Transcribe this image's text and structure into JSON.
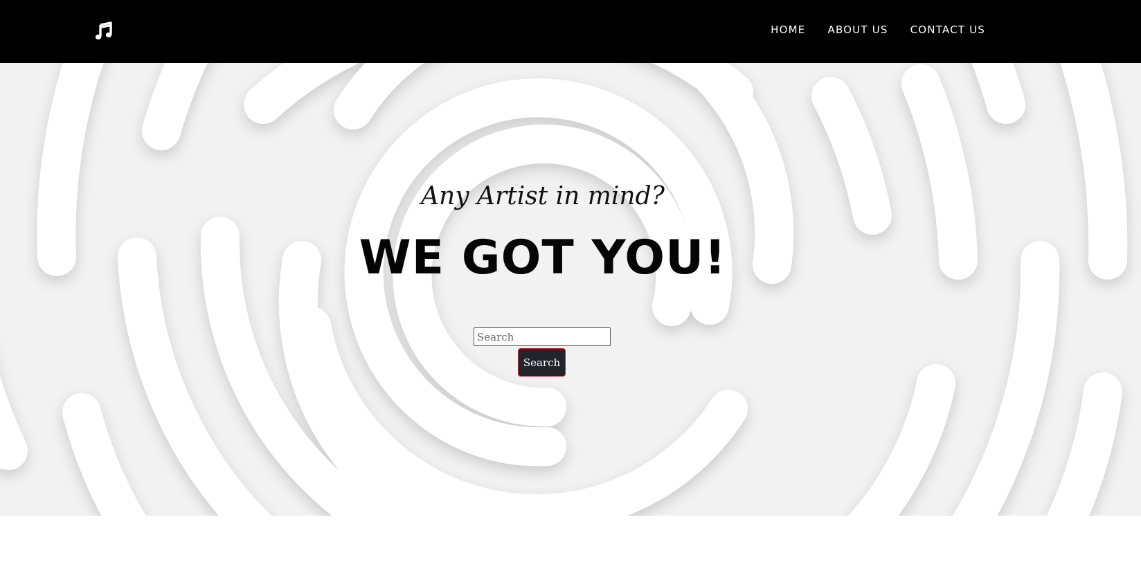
{
  "nav": {
    "logo_icon": "music-note-icon",
    "links": [
      "HOME",
      "ABOUT US",
      "CONTACT US"
    ]
  },
  "hero": {
    "tagline": "Any Artist in mind?",
    "headline": "WE GOT YOU!",
    "search_placeholder": "Search",
    "search_value": "",
    "search_button_label": "Search"
  },
  "colors": {
    "navbar_bg": "#000000",
    "hero_bg": "#f2f2f2",
    "button_bg": "#212529",
    "button_border": "#c0263a"
  }
}
